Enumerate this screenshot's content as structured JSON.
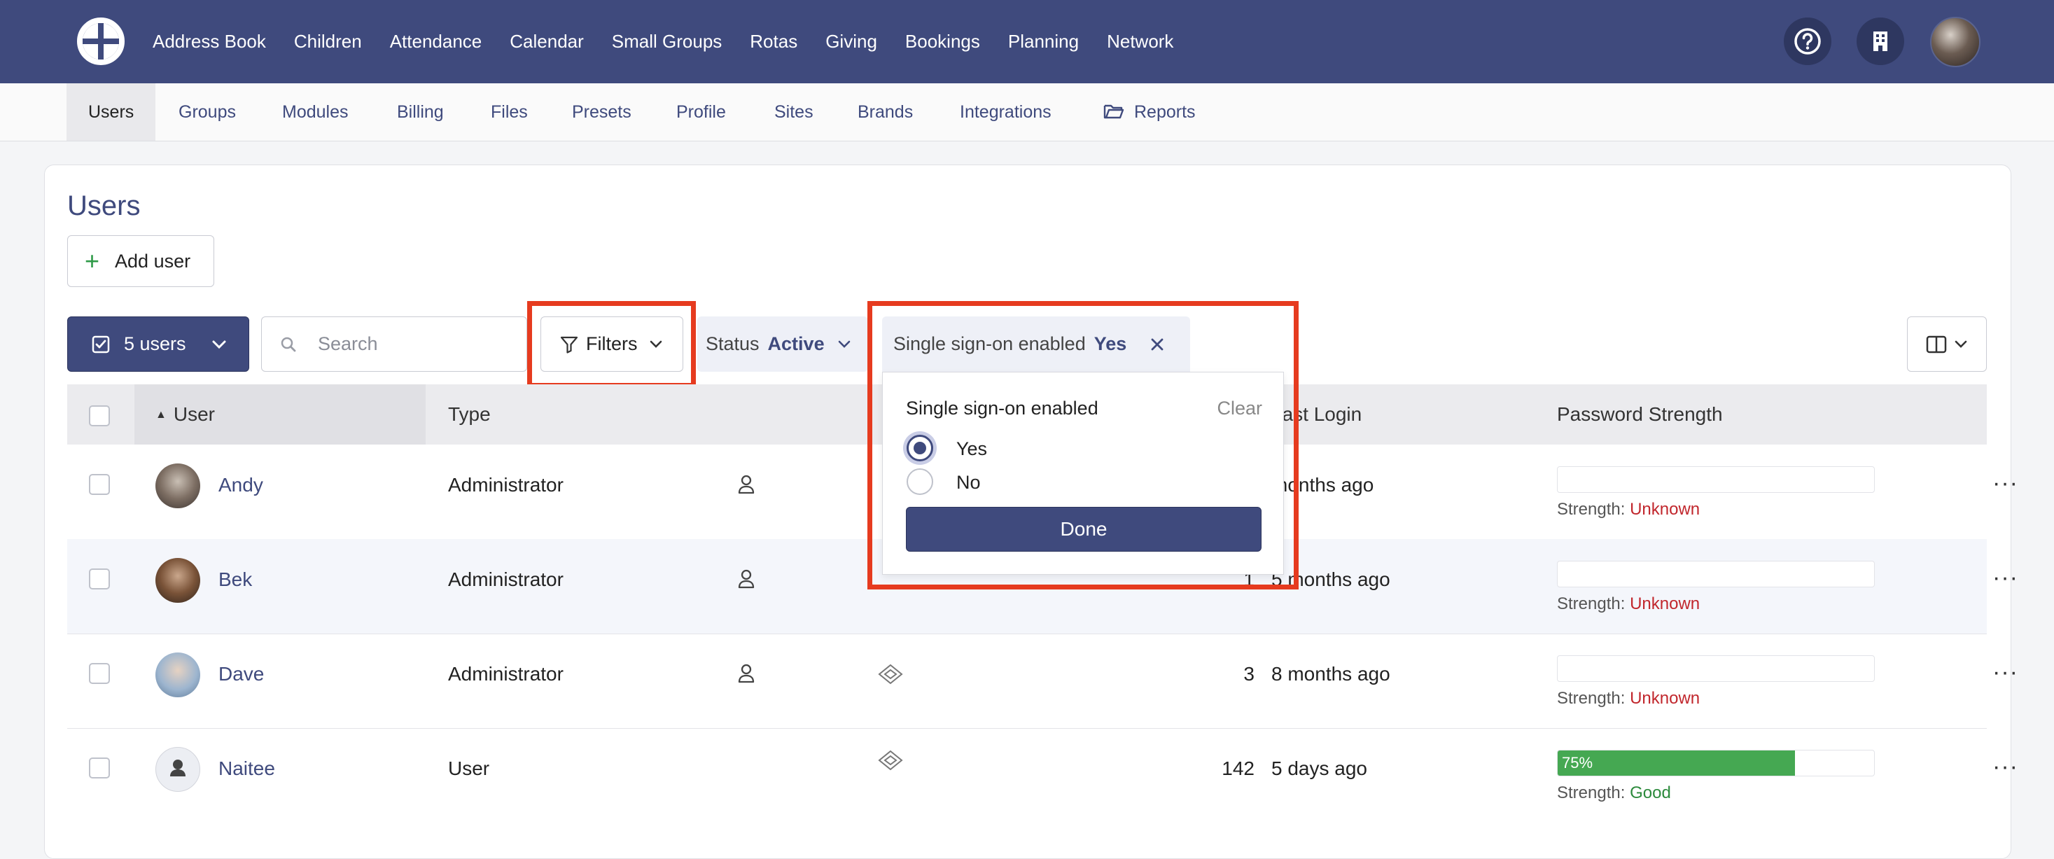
{
  "topnav": {
    "items": [
      "Address Book",
      "Children",
      "Attendance",
      "Calendar",
      "Small Groups",
      "Rotas",
      "Giving",
      "Bookings",
      "Planning",
      "Network"
    ],
    "help_icon": "help-circle-icon",
    "org_icon": "building-icon"
  },
  "subnav": {
    "items": [
      "Users",
      "Groups",
      "Modules",
      "Billing",
      "Files",
      "Presets",
      "Profile",
      "Sites",
      "Brands",
      "Integrations",
      "Reports"
    ],
    "active": "Users"
  },
  "page": {
    "title": "Users",
    "add_user_label": "Add user"
  },
  "toolbar": {
    "users_count_label": "5 users",
    "search_placeholder": "Search",
    "filters_label": "Filters",
    "status_label": "Status",
    "status_value": "Active",
    "sso_label": "Single sign-on enabled",
    "sso_value": "Yes"
  },
  "popover": {
    "title": "Single sign-on enabled",
    "clear_label": "Clear",
    "options": [
      "Yes",
      "No"
    ],
    "selected": "Yes",
    "done_label": "Done"
  },
  "table": {
    "headers": {
      "user": "User",
      "type": "Type",
      "last_login": "Last Login",
      "password_strength": "Password Strength"
    },
    "strength_prefix": "Strength:",
    "rows": [
      {
        "name": "Andy",
        "type": "Administrator",
        "logins": "",
        "last_login": "months ago",
        "strength": "Unknown",
        "percent": ""
      },
      {
        "name": "Bek",
        "type": "Administrator",
        "logins": "1",
        "last_login": "5 months ago",
        "strength": "Unknown",
        "percent": ""
      },
      {
        "name": "Dave",
        "type": "Administrator",
        "logins": "3",
        "last_login": "8 months ago",
        "strength": "Unknown",
        "percent": ""
      },
      {
        "name": "Naitee",
        "type": "User",
        "logins": "142",
        "last_login": "5 days ago",
        "strength": "Good",
        "percent": "75%"
      }
    ]
  },
  "colors": {
    "brand": "#3f4a7d",
    "highlight": "#e63b1f",
    "good": "#45a852",
    "unknown": "#c1272d"
  }
}
